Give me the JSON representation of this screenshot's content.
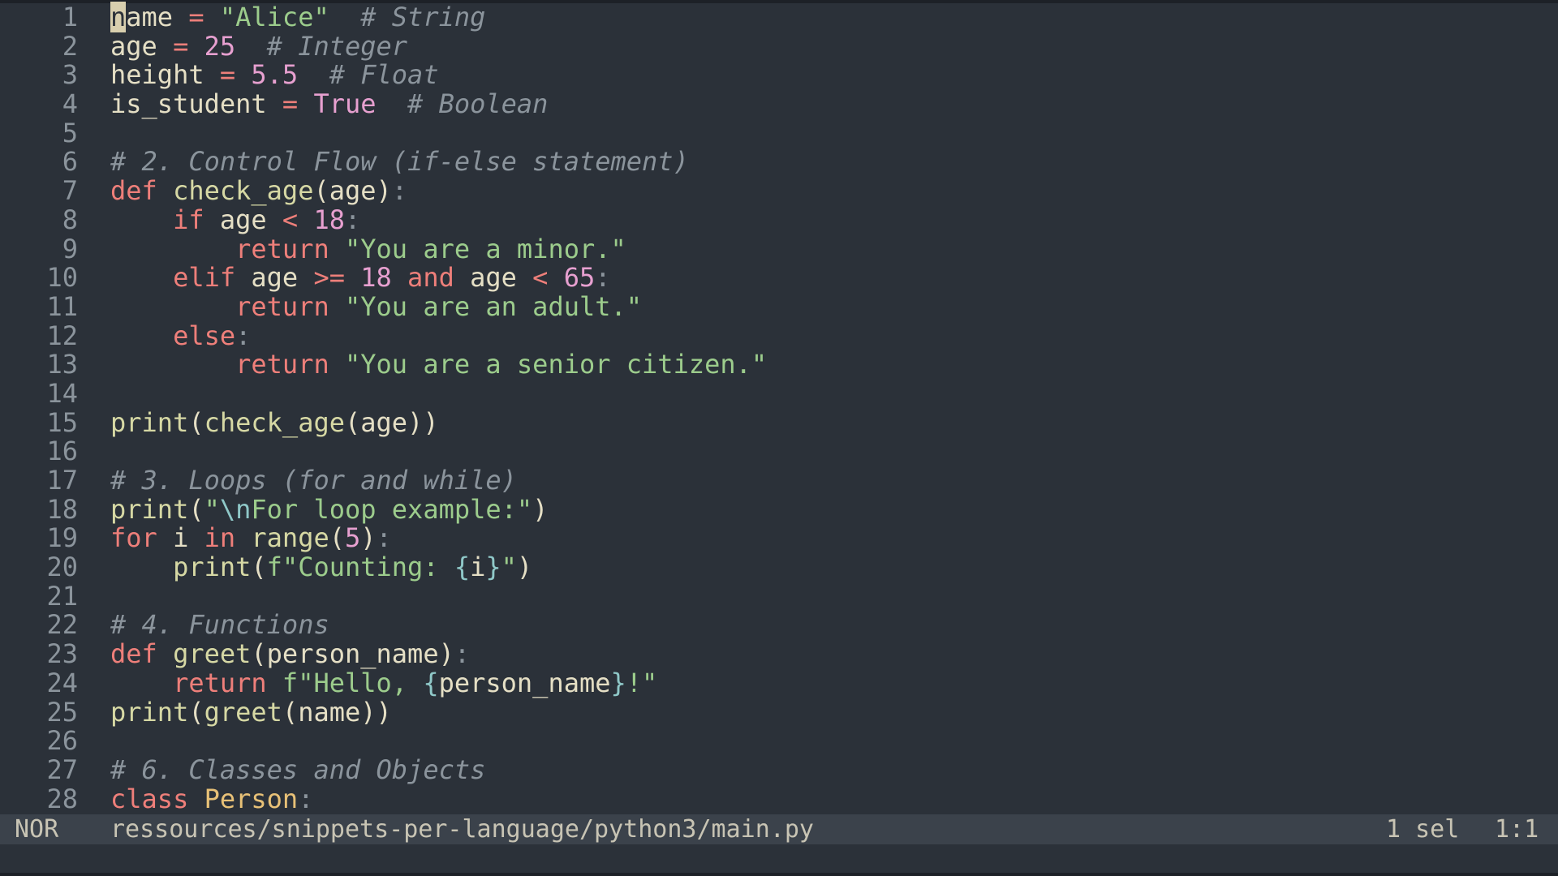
{
  "file": {
    "path": "ressources/snippets-per-language/python3/main.py"
  },
  "status": {
    "mode": "NOR",
    "selection": "1 sel",
    "position": "1:1"
  },
  "lines": [
    {
      "n": "1",
      "tokens": [
        {
          "t": "n",
          "c": "cursor"
        },
        {
          "t": "ame ",
          "c": "plain"
        },
        {
          "t": "=",
          "c": "op"
        },
        {
          "t": " ",
          "c": "plain"
        },
        {
          "t": "\"Alice\"",
          "c": "str"
        },
        {
          "t": "  ",
          "c": "plain"
        },
        {
          "t": "# String",
          "c": "com"
        }
      ]
    },
    {
      "n": "2",
      "tokens": [
        {
          "t": "age ",
          "c": "plain"
        },
        {
          "t": "=",
          "c": "op"
        },
        {
          "t": " ",
          "c": "plain"
        },
        {
          "t": "25",
          "c": "num"
        },
        {
          "t": "  ",
          "c": "plain"
        },
        {
          "t": "# Integer",
          "c": "com"
        }
      ]
    },
    {
      "n": "3",
      "tokens": [
        {
          "t": "height ",
          "c": "plain"
        },
        {
          "t": "=",
          "c": "op"
        },
        {
          "t": " ",
          "c": "plain"
        },
        {
          "t": "5.5",
          "c": "num"
        },
        {
          "t": "  ",
          "c": "plain"
        },
        {
          "t": "# Float",
          "c": "com"
        }
      ]
    },
    {
      "n": "4",
      "tokens": [
        {
          "t": "is_student ",
          "c": "plain"
        },
        {
          "t": "=",
          "c": "op"
        },
        {
          "t": " ",
          "c": "plain"
        },
        {
          "t": "True",
          "c": "num"
        },
        {
          "t": "  ",
          "c": "plain"
        },
        {
          "t": "# Boolean",
          "c": "com"
        }
      ]
    },
    {
      "n": "5",
      "tokens": []
    },
    {
      "n": "6",
      "tokens": [
        {
          "t": "# 2. Control Flow (if-else statement)",
          "c": "com"
        }
      ]
    },
    {
      "n": "7",
      "tokens": [
        {
          "t": "def",
          "c": "kw"
        },
        {
          "t": " ",
          "c": "plain"
        },
        {
          "t": "check_age",
          "c": "fn"
        },
        {
          "t": "(age)",
          "c": "plain"
        },
        {
          "t": ":",
          "c": "punc"
        }
      ]
    },
    {
      "n": "8",
      "tokens": [
        {
          "t": "    ",
          "c": "plain"
        },
        {
          "t": "if",
          "c": "kw"
        },
        {
          "t": " age ",
          "c": "plain"
        },
        {
          "t": "<",
          "c": "op"
        },
        {
          "t": " ",
          "c": "plain"
        },
        {
          "t": "18",
          "c": "num"
        },
        {
          "t": ":",
          "c": "punc"
        }
      ]
    },
    {
      "n": "9",
      "tokens": [
        {
          "t": "        ",
          "c": "plain"
        },
        {
          "t": "return",
          "c": "kw"
        },
        {
          "t": " ",
          "c": "plain"
        },
        {
          "t": "\"You are a minor.\"",
          "c": "str"
        }
      ]
    },
    {
      "n": "10",
      "tokens": [
        {
          "t": "    ",
          "c": "plain"
        },
        {
          "t": "elif",
          "c": "kw"
        },
        {
          "t": " age ",
          "c": "plain"
        },
        {
          "t": ">=",
          "c": "op"
        },
        {
          "t": " ",
          "c": "plain"
        },
        {
          "t": "18",
          "c": "num"
        },
        {
          "t": " ",
          "c": "plain"
        },
        {
          "t": "and",
          "c": "kw"
        },
        {
          "t": " age ",
          "c": "plain"
        },
        {
          "t": "<",
          "c": "op"
        },
        {
          "t": " ",
          "c": "plain"
        },
        {
          "t": "65",
          "c": "num"
        },
        {
          "t": ":",
          "c": "punc"
        }
      ]
    },
    {
      "n": "11",
      "tokens": [
        {
          "t": "        ",
          "c": "plain"
        },
        {
          "t": "return",
          "c": "kw"
        },
        {
          "t": " ",
          "c": "plain"
        },
        {
          "t": "\"You are an adult.\"",
          "c": "str"
        }
      ]
    },
    {
      "n": "12",
      "tokens": [
        {
          "t": "    ",
          "c": "plain"
        },
        {
          "t": "else",
          "c": "kw"
        },
        {
          "t": ":",
          "c": "punc"
        }
      ]
    },
    {
      "n": "13",
      "tokens": [
        {
          "t": "        ",
          "c": "plain"
        },
        {
          "t": "return",
          "c": "kw"
        },
        {
          "t": " ",
          "c": "plain"
        },
        {
          "t": "\"You are a senior citizen.\"",
          "c": "str"
        }
      ]
    },
    {
      "n": "14",
      "tokens": []
    },
    {
      "n": "15",
      "tokens": [
        {
          "t": "print",
          "c": "fn"
        },
        {
          "t": "(",
          "c": "plain"
        },
        {
          "t": "check_age",
          "c": "fn"
        },
        {
          "t": "(age))",
          "c": "plain"
        }
      ]
    },
    {
      "n": "16",
      "tokens": []
    },
    {
      "n": "17",
      "tokens": [
        {
          "t": "# 3. Loops (for and while)",
          "c": "com"
        }
      ]
    },
    {
      "n": "18",
      "tokens": [
        {
          "t": "print",
          "c": "fn"
        },
        {
          "t": "(",
          "c": "plain"
        },
        {
          "t": "\"",
          "c": "str"
        },
        {
          "t": "\\n",
          "c": "esc"
        },
        {
          "t": "For loop example:\"",
          "c": "str"
        },
        {
          "t": ")",
          "c": "plain"
        }
      ]
    },
    {
      "n": "19",
      "tokens": [
        {
          "t": "for",
          "c": "kw"
        },
        {
          "t": " i ",
          "c": "plain"
        },
        {
          "t": "in",
          "c": "kw"
        },
        {
          "t": " ",
          "c": "plain"
        },
        {
          "t": "range",
          "c": "fn"
        },
        {
          "t": "(",
          "c": "plain"
        },
        {
          "t": "5",
          "c": "num"
        },
        {
          "t": ")",
          "c": "plain"
        },
        {
          "t": ":",
          "c": "punc"
        }
      ]
    },
    {
      "n": "20",
      "tokens": [
        {
          "t": "    ",
          "c": "plain"
        },
        {
          "t": "print",
          "c": "fn"
        },
        {
          "t": "(",
          "c": "plain"
        },
        {
          "t": "f\"Counting: ",
          "c": "str"
        },
        {
          "t": "{",
          "c": "esc"
        },
        {
          "t": "i",
          "c": "plain"
        },
        {
          "t": "}",
          "c": "esc"
        },
        {
          "t": "\"",
          "c": "str"
        },
        {
          "t": ")",
          "c": "plain"
        }
      ]
    },
    {
      "n": "21",
      "tokens": []
    },
    {
      "n": "22",
      "tokens": [
        {
          "t": "# 4. Functions",
          "c": "com"
        }
      ]
    },
    {
      "n": "23",
      "tokens": [
        {
          "t": "def",
          "c": "kw"
        },
        {
          "t": " ",
          "c": "plain"
        },
        {
          "t": "greet",
          "c": "fn"
        },
        {
          "t": "(person_name)",
          "c": "plain"
        },
        {
          "t": ":",
          "c": "punc"
        }
      ]
    },
    {
      "n": "24",
      "tokens": [
        {
          "t": "    ",
          "c": "plain"
        },
        {
          "t": "return",
          "c": "kw"
        },
        {
          "t": " ",
          "c": "plain"
        },
        {
          "t": "f\"Hello, ",
          "c": "str"
        },
        {
          "t": "{",
          "c": "esc"
        },
        {
          "t": "person_name",
          "c": "plain"
        },
        {
          "t": "}",
          "c": "esc"
        },
        {
          "t": "!\"",
          "c": "str"
        }
      ]
    },
    {
      "n": "25",
      "tokens": [
        {
          "t": "print",
          "c": "fn"
        },
        {
          "t": "(",
          "c": "plain"
        },
        {
          "t": "greet",
          "c": "fn"
        },
        {
          "t": "(name))",
          "c": "plain"
        }
      ]
    },
    {
      "n": "26",
      "tokens": []
    },
    {
      "n": "27",
      "tokens": [
        {
          "t": "# 6. Classes and Objects",
          "c": "com"
        }
      ]
    },
    {
      "n": "28",
      "tokens": [
        {
          "t": "class",
          "c": "kw"
        },
        {
          "t": " ",
          "c": "plain"
        },
        {
          "t": "Person",
          "c": "cls"
        },
        {
          "t": ":",
          "c": "punc"
        }
      ]
    }
  ],
  "colors": {
    "background": "#2b3139",
    "statusbar": "#3b424b",
    "keyword": "#ee7f7a",
    "string": "#9ccc8c",
    "number": "#e7a0d0",
    "comment": "#8b949c",
    "function": "#d6d8a4",
    "class": "#e8c177"
  }
}
